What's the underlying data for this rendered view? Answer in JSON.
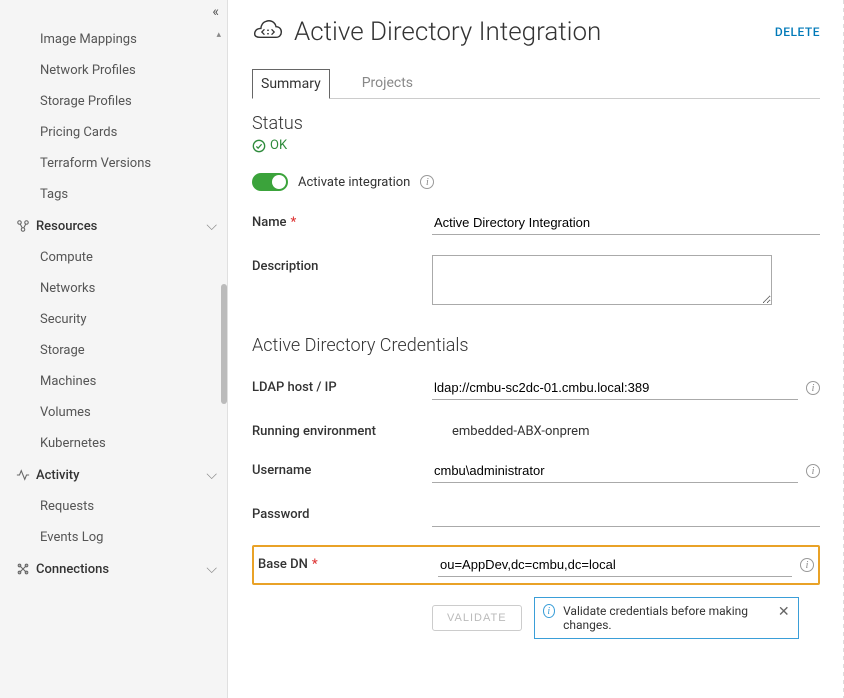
{
  "sidebar": {
    "items_top": [
      {
        "label": "Image Mappings"
      },
      {
        "label": "Network Profiles"
      },
      {
        "label": "Storage Profiles"
      },
      {
        "label": "Pricing Cards"
      },
      {
        "label": "Terraform Versions"
      },
      {
        "label": "Tags"
      }
    ],
    "section_resources": {
      "label": "Resources",
      "icon": "resources-icon"
    },
    "items_resources": [
      {
        "label": "Compute"
      },
      {
        "label": "Networks"
      },
      {
        "label": "Security"
      },
      {
        "label": "Storage"
      },
      {
        "label": "Machines"
      },
      {
        "label": "Volumes"
      },
      {
        "label": "Kubernetes"
      }
    ],
    "section_activity": {
      "label": "Activity",
      "icon": "activity-icon"
    },
    "items_activity": [
      {
        "label": "Requests"
      },
      {
        "label": "Events Log"
      }
    ],
    "section_connections": {
      "label": "Connections",
      "icon": "connections-icon"
    }
  },
  "header": {
    "title": "Active Directory Integration",
    "delete_label": "DELETE"
  },
  "tabs": {
    "summary": "Summary",
    "projects": "Projects"
  },
  "status": {
    "label": "Status",
    "ok": "OK"
  },
  "toggle": {
    "label": "Activate integration"
  },
  "form": {
    "name_label": "Name",
    "name_value": "Active Directory Integration",
    "description_label": "Description",
    "description_value": ""
  },
  "credentials": {
    "section_label": "Active Directory Credentials",
    "ldap_label": "LDAP host / IP",
    "ldap_value": "ldap://cmbu-sc2dc-01.cmbu.local:389",
    "runenv_label": "Running environment",
    "runenv_value": "embedded-ABX-onprem",
    "username_label": "Username",
    "username_value": "cmbu\\administrator",
    "password_label": "Password",
    "password_value": "",
    "basedn_label": "Base DN",
    "basedn_value": "ou=AppDev,dc=cmbu,dc=local",
    "validate_label": "VALIDATE",
    "notice_text": "Validate credentials before making changes."
  }
}
